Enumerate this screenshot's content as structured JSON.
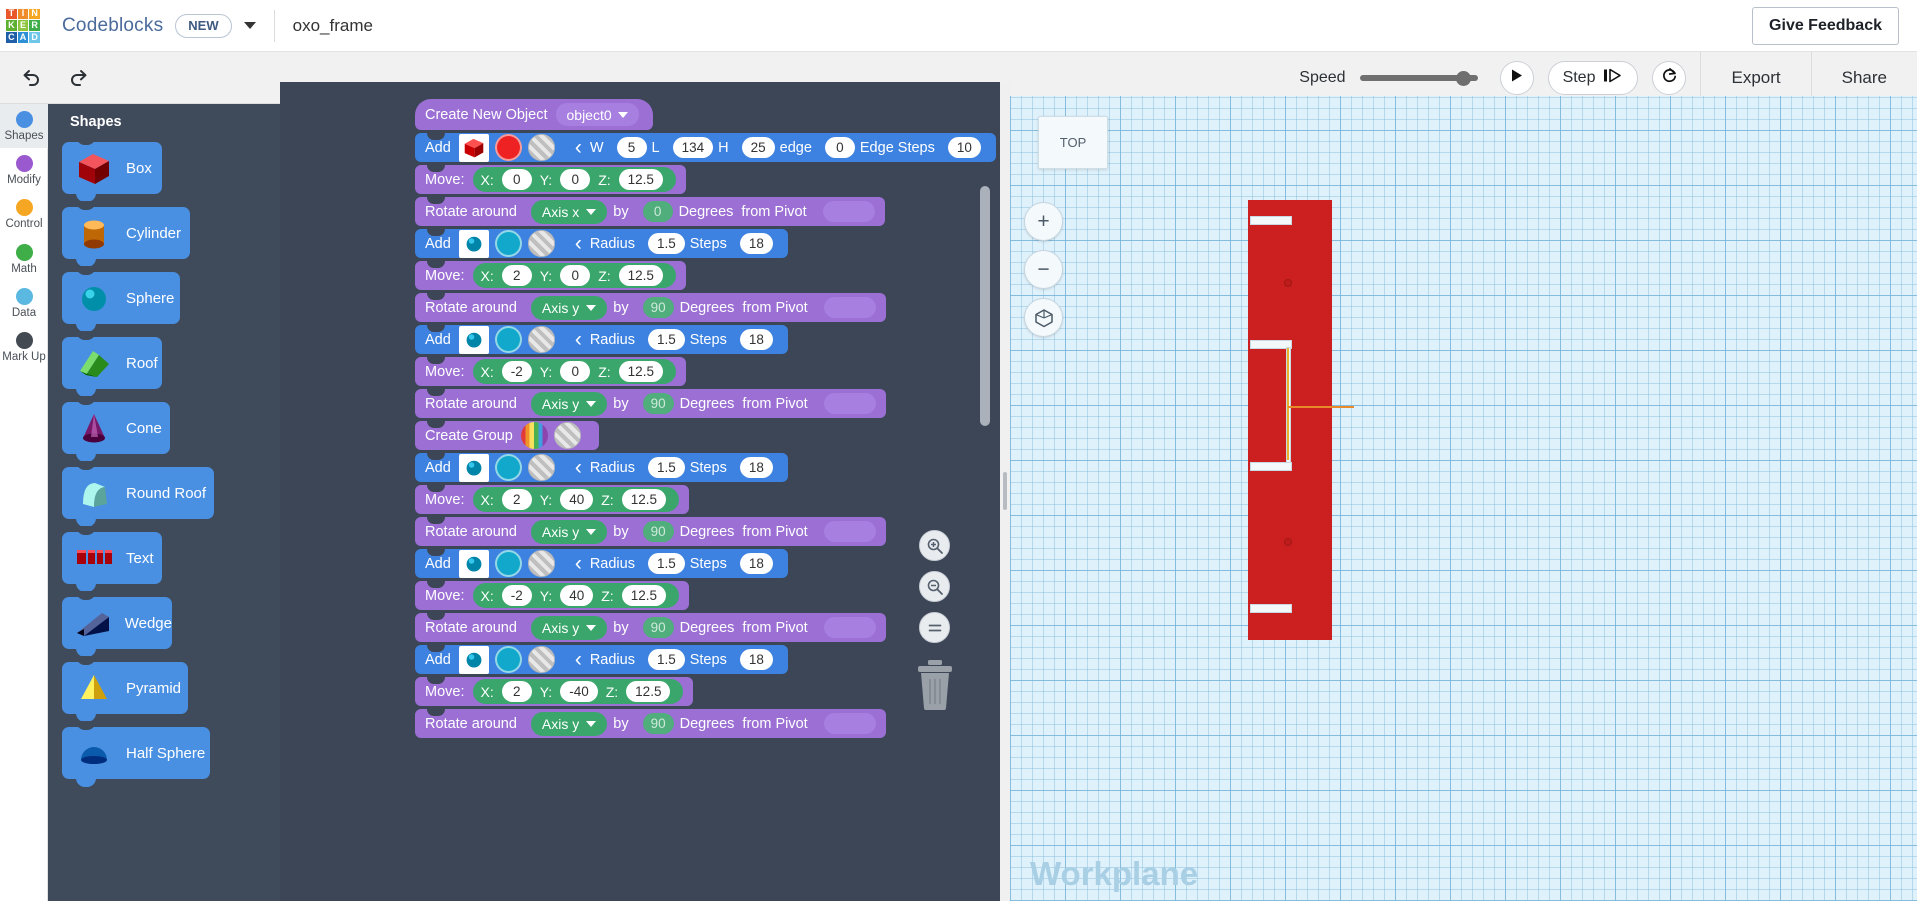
{
  "app": {
    "brand": "Codeblocks",
    "new_badge": "NEW",
    "document_title": "oxo_frame",
    "feedback_button": "Give Feedback"
  },
  "logo": {
    "letters": [
      "T",
      "I",
      "N",
      "K",
      "E",
      "R",
      "C",
      "A",
      "D"
    ],
    "colors": [
      "#e8562a",
      "#f08b2a",
      "#f5a623",
      "#5eb130",
      "#8cc63f",
      "#3fae49",
      "#1f5fa8",
      "#2d8fd5",
      "#6ec6e8"
    ]
  },
  "toolbar": {
    "undo_icon": "undo-icon",
    "redo_icon": "redo-icon",
    "speed_label": "Speed",
    "speed_value": 88,
    "play_icon": "play-icon",
    "step_label": "Step",
    "step_icon": "step-forward-icon",
    "restart_icon": "restart-icon",
    "export_label": "Export",
    "share_label": "Share"
  },
  "rail": {
    "items": [
      {
        "label": "Shapes",
        "color": "#4a90e2",
        "active": true
      },
      {
        "label": "Modify",
        "color": "#9b59d0",
        "active": false
      },
      {
        "label": "Control",
        "color": "#f5a623",
        "active": false
      },
      {
        "label": "Math",
        "color": "#3fae49",
        "active": false
      },
      {
        "label": "Data",
        "color": "#5bb8e0",
        "active": false
      },
      {
        "label": "Mark Up",
        "color": "#444a52",
        "active": false
      }
    ]
  },
  "shapes_panel": {
    "title": "Shapes",
    "items": [
      {
        "label": "Box",
        "icon": "box-shape-icon",
        "color": "#c4272d"
      },
      {
        "label": "Cylinder",
        "icon": "cylinder-shape-icon",
        "color": "#e28b2a"
      },
      {
        "label": "Sphere",
        "icon": "sphere-shape-icon",
        "color": "#1ab3cc"
      },
      {
        "label": "Roof",
        "icon": "roof-shape-icon",
        "color": "#4caf3f"
      },
      {
        "label": "Cone",
        "icon": "cone-shape-icon",
        "color": "#9b3d8f"
      },
      {
        "label": "Round Roof",
        "icon": "round-roof-shape-icon",
        "color": "#7fc8c0"
      },
      {
        "label": "Text",
        "icon": "text-shape-icon",
        "color": "#cc1f2e"
      },
      {
        "label": "Wedge",
        "icon": "wedge-shape-icon",
        "color": "#26356b"
      },
      {
        "label": "Pyramid",
        "icon": "pyramid-shape-icon",
        "color": "#f2c430"
      },
      {
        "label": "Half Sphere",
        "icon": "half-sphere-shape-icon",
        "color": "#2f7fd0"
      }
    ]
  },
  "code": {
    "blocks": [
      {
        "type": "hat",
        "color": "purple",
        "label": "Create New Object",
        "dropdown": "object0"
      },
      {
        "type": "add",
        "color": "blue",
        "label": "Add",
        "shape": "box-swatch",
        "color_swatch": "#ee2222",
        "params": [
          {
            "name": "W",
            "value": "5"
          },
          {
            "name": "L",
            "value": "134"
          },
          {
            "name": "H",
            "value": "25"
          },
          {
            "name": "edge",
            "value": "0"
          },
          {
            "name": "Edge Steps",
            "value": "10"
          }
        ]
      },
      {
        "type": "move",
        "color": "purple",
        "label": "Move:",
        "x": "0",
        "y": "0",
        "z": "12.5"
      },
      {
        "type": "rotate",
        "color": "purple",
        "label": "Rotate around",
        "axis": "Axis x",
        "by": "by",
        "degrees": "0",
        "degrees_label": "Degrees",
        "pivot_label": "from Pivot"
      },
      {
        "type": "add",
        "color": "blue",
        "label": "Add",
        "shape": "sphere-swatch",
        "color_swatch": "#12a8cc",
        "params": [
          {
            "name": "Radius",
            "value": "1.5"
          },
          {
            "name": "Steps",
            "value": "18"
          }
        ]
      },
      {
        "type": "move",
        "color": "purple",
        "label": "Move:",
        "x": "2",
        "y": "0",
        "z": "12.5"
      },
      {
        "type": "rotate",
        "color": "purple",
        "label": "Rotate around",
        "axis": "Axis y",
        "by": "by",
        "degrees": "90",
        "degrees_label": "Degrees",
        "pivot_label": "from Pivot"
      },
      {
        "type": "add",
        "color": "blue",
        "label": "Add",
        "shape": "sphere-swatch",
        "color_swatch": "#12a8cc",
        "params": [
          {
            "name": "Radius",
            "value": "1.5"
          },
          {
            "name": "Steps",
            "value": "18"
          }
        ]
      },
      {
        "type": "move",
        "color": "purple",
        "label": "Move:",
        "x": "-2",
        "y": "0",
        "z": "12.5"
      },
      {
        "type": "rotate",
        "color": "purple",
        "label": "Rotate around",
        "axis": "Axis y",
        "by": "by",
        "degrees": "90",
        "degrees_label": "Degrees",
        "pivot_label": "from Pivot"
      },
      {
        "type": "group",
        "color": "purple",
        "label": "Create Group"
      },
      {
        "type": "add",
        "color": "blue",
        "label": "Add",
        "shape": "sphere-swatch",
        "color_swatch": "#12a8cc",
        "params": [
          {
            "name": "Radius",
            "value": "1.5"
          },
          {
            "name": "Steps",
            "value": "18"
          }
        ]
      },
      {
        "type": "move",
        "color": "purple",
        "label": "Move:",
        "x": "2",
        "y": "40",
        "z": "12.5"
      },
      {
        "type": "rotate",
        "color": "purple",
        "label": "Rotate around",
        "axis": "Axis y",
        "by": "by",
        "degrees": "90",
        "degrees_label": "Degrees",
        "pivot_label": "from Pivot"
      },
      {
        "type": "add",
        "color": "blue",
        "label": "Add",
        "shape": "sphere-swatch",
        "color_swatch": "#12a8cc",
        "params": [
          {
            "name": "Radius",
            "value": "1.5"
          },
          {
            "name": "Steps",
            "value": "18"
          }
        ]
      },
      {
        "type": "move",
        "color": "purple",
        "label": "Move:",
        "x": "-2",
        "y": "40",
        "z": "12.5"
      },
      {
        "type": "rotate",
        "color": "purple",
        "label": "Rotate around",
        "axis": "Axis y",
        "by": "by",
        "degrees": "90",
        "degrees_label": "Degrees",
        "pivot_label": "from Pivot"
      },
      {
        "type": "add",
        "color": "blue",
        "label": "Add",
        "shape": "sphere-swatch",
        "color_swatch": "#12a8cc",
        "params": [
          {
            "name": "Radius",
            "value": "1.5"
          },
          {
            "name": "Steps",
            "value": "18"
          }
        ]
      },
      {
        "type": "move",
        "color": "purple",
        "label": "Move:",
        "x": "2",
        "y": "-40",
        "z": "12.5"
      },
      {
        "type": "rotate",
        "color": "purple",
        "label": "Rotate around",
        "axis": "Axis y",
        "by": "by",
        "degrees": "90",
        "degrees_label": "Degrees",
        "pivot_label": "from Pivot"
      }
    ],
    "zoom_in_icon": "zoom-in-icon",
    "zoom_out_icon": "zoom-out-icon",
    "zoom_reset_icon": "zoom-reset-icon",
    "trash_icon": "trash-icon"
  },
  "viewport": {
    "view_label": "TOP",
    "zoom_in_icon": "plus-icon",
    "zoom_out_icon": "minus-icon",
    "fit_icon": "fit-view-icon",
    "workplane_label": "Workplane",
    "model_color": "#cc1f1f"
  }
}
